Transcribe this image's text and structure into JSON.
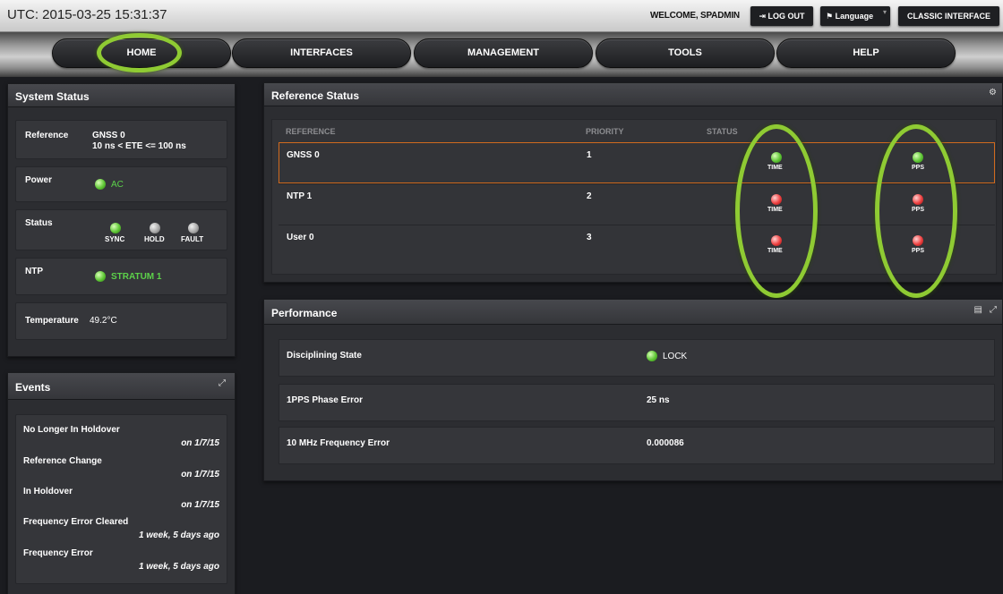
{
  "topbar": {
    "utc": "UTC: 2015-03-25 15:31:37",
    "welcome": "WELCOME, SPADMIN",
    "logout_label": "LOG OUT",
    "language_label": "Language",
    "classic_label": "CLASSIC INTERFACE"
  },
  "nav": {
    "items": [
      "HOME",
      "INTERFACES",
      "MANAGEMENT",
      "TOOLS",
      "HELP"
    ],
    "active": "HOME"
  },
  "system_status": {
    "title": "System Status",
    "reference_label": "Reference",
    "reference_value": "GNSS 0",
    "reference_detail": "10 ns < ETE <= 100 ns",
    "power_label": "Power",
    "power_value": "AC",
    "status_label": "Status",
    "status_indicators": [
      "SYNC",
      "HOLD",
      "FAULT"
    ],
    "ntp_label": "NTP",
    "ntp_value": "STRATUM 1",
    "temperature_label": "Temperature",
    "temperature_value": "49.2°C"
  },
  "events": {
    "title": "Events",
    "items": [
      {
        "name": "No Longer In Holdover",
        "time": "on 1/7/15"
      },
      {
        "name": "Reference Change",
        "time": "on 1/7/15"
      },
      {
        "name": "In Holdover",
        "time": "on 1/7/15"
      },
      {
        "name": "Frequency Error Cleared",
        "time": "1 week, 5 days ago"
      },
      {
        "name": "Frequency Error",
        "time": "1 week, 5 days ago"
      }
    ]
  },
  "reference_status": {
    "title": "Reference Status",
    "columns": [
      "REFERENCE",
      "PRIORITY",
      "STATUS"
    ],
    "rows": [
      {
        "reference": "GNSS 0",
        "priority": "1",
        "time": "TIME",
        "pps": "PPS",
        "time_state": "green",
        "pps_state": "green",
        "selected": true
      },
      {
        "reference": "NTP 1",
        "priority": "2",
        "time": "TIME",
        "pps": "PPS",
        "time_state": "red",
        "pps_state": "red",
        "selected": false
      },
      {
        "reference": "User 0",
        "priority": "3",
        "time": "TIME",
        "pps": "PPS",
        "time_state": "red",
        "pps_state": "red",
        "selected": false
      }
    ]
  },
  "performance": {
    "title": "Performance",
    "rows": [
      {
        "label": "Disciplining State",
        "value": "LOCK"
      },
      {
        "label": "1PPS Phase Error",
        "value": "25 ns"
      },
      {
        "label": "10 MHz Frequency Error",
        "value": "0.000086"
      }
    ]
  },
  "colors": {
    "highlight_ring": "#8fcb33",
    "selected_row_border": "#d06a1e",
    "status_green": "#5cd14a",
    "status_red": "#ee4040"
  }
}
